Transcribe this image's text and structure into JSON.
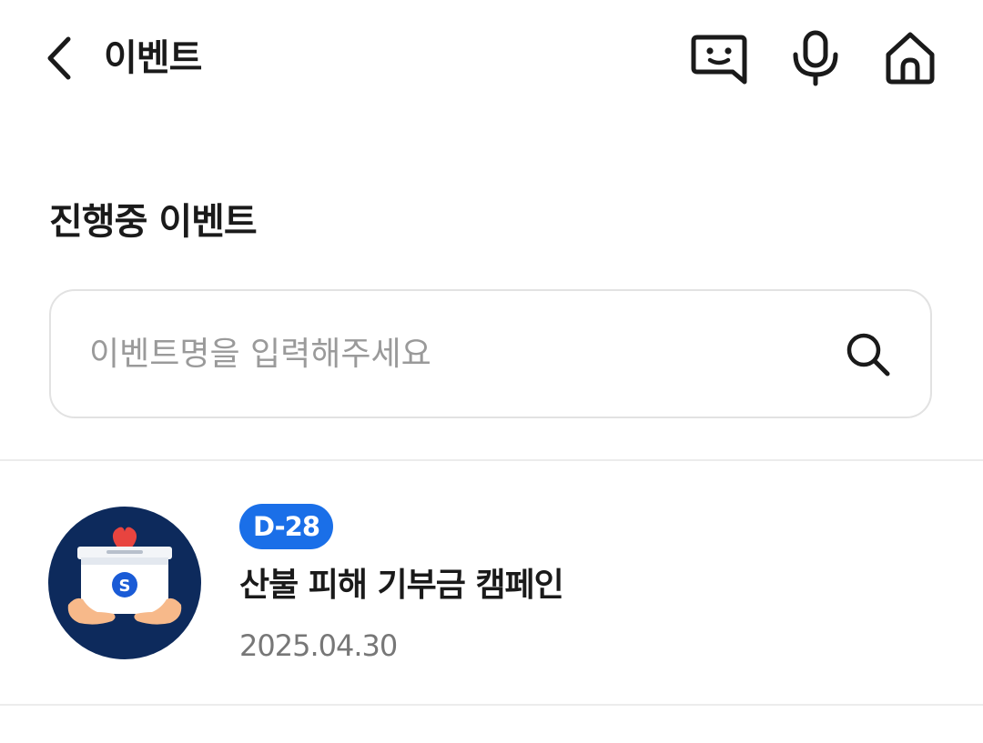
{
  "header": {
    "title": "이벤트",
    "icons": [
      "back-arrow-icon",
      "chatbot-icon",
      "microphone-icon",
      "home-icon"
    ]
  },
  "section": {
    "title": "진행중 이벤트"
  },
  "search": {
    "placeholder": "이벤트명을 입력해주세요",
    "value": "",
    "icon": "search-icon"
  },
  "events": [
    {
      "badge": "D-28",
      "title": "산불 피해 기부금 캠페인",
      "date": "2025.04.30"
    }
  ],
  "colors": {
    "badge_bg": "#1a6fe8",
    "thumb_bg": "#0d2a5c",
    "heart": "#e8443f"
  }
}
